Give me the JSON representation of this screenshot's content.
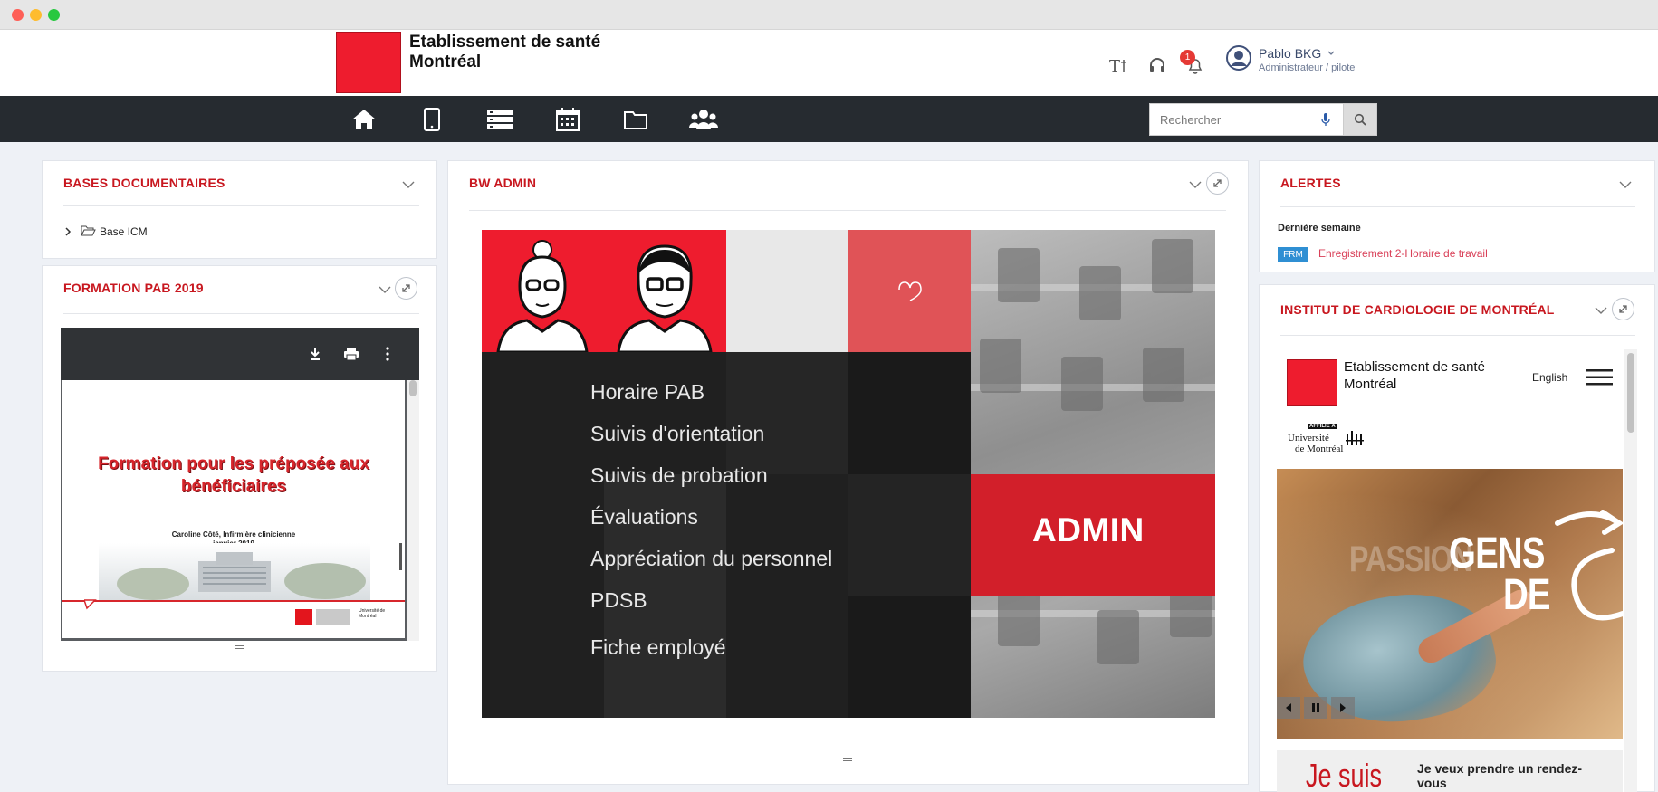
{
  "header": {
    "org_name_line1": "Etablissement de santé",
    "org_name_line2": "Montréal",
    "notifications_count": "1",
    "user_name": "Pablo BKG",
    "user_role": "Administrateur / pilote",
    "icons": [
      "text-size-icon",
      "headset-icon",
      "bell-icon",
      "user-avatar-icon"
    ]
  },
  "nav": {
    "items": [
      "home-icon",
      "tablet-icon",
      "list-icon",
      "calendar-icon",
      "folder-icon",
      "users-icon"
    ],
    "search_placeholder": "Rechercher"
  },
  "panels": {
    "bases": {
      "title": "BASES DOCUMENTAIRES",
      "tree": [
        {
          "label": "Base ICM"
        }
      ]
    },
    "formation": {
      "title": "FORMATION PAB 2019",
      "slide_title_line1": "Formation pour les préposée aux",
      "slide_title_line2": "bénéficiaires",
      "slide_author_line1": "Caroline Côté, Infirmière clinicienne",
      "slide_author_line2": "janvier 2019",
      "slide_logo_text": "Université de Montréal"
    },
    "bw_admin": {
      "title": "BW ADMIN",
      "menu": [
        "Horaire PAB",
        "Suivis d'orientation",
        "Suivis de probation",
        "Évaluations",
        "Appréciation du personnel",
        "PDSB",
        "Fiche employé"
      ],
      "tile_label": "ADMIN"
    },
    "alertes": {
      "title": "ALERTES",
      "section": "Dernière semaine",
      "items": [
        {
          "tag": "FRM",
          "label": "Enregistrement 2-Horaire de travail"
        }
      ]
    },
    "institut": {
      "title": "INSTITUT DE CARDIOLOGIE DE MONTRÉAL",
      "site_name_line1": "Etablissement de santé",
      "site_name_line2": "Montréal",
      "language": "English",
      "affiliation_line1": "AFFILIÉ À",
      "affiliation_line2": "Université",
      "affiliation_line3": "de Montréal",
      "hero_line1": "GENS",
      "hero_line2": "DE",
      "hero_ghost": "PASSION",
      "tagline": "Je suis",
      "cta": "Je veux prendre un rendez-vous"
    }
  },
  "colors": {
    "brand_red": "#ee1c2e",
    "title_red": "#c8171f",
    "navbar": "#262b30",
    "frm_tag": "#2f8fd3"
  }
}
